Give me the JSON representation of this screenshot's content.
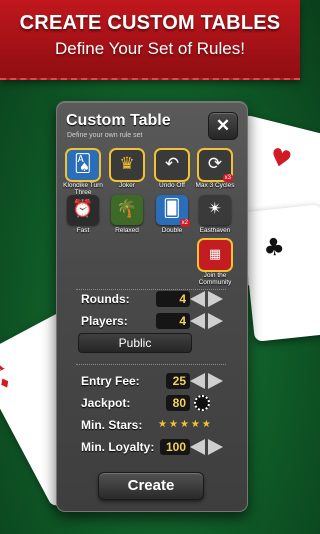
{
  "banner": {
    "title": "CREATE CUSTOM TABLES",
    "subtitle": "Define Your Set of Rules!"
  },
  "panel": {
    "title": "Custom Table",
    "subtitle": "Define your own rule set"
  },
  "rules": [
    {
      "label": "Klondike Turn Three",
      "icon": "cards-icon",
      "selected": true
    },
    {
      "label": "Joker",
      "icon": "jester-hat-icon",
      "selected": true
    },
    {
      "label": "Undo Off",
      "icon": "undo-icon",
      "selected": true
    },
    {
      "label": "Max 3 Cycles",
      "icon": "cycle-icon",
      "badge": "x3",
      "selected": true
    },
    {
      "label": "Fast",
      "icon": "clock-icon",
      "selected": false
    },
    {
      "label": "Relaxed",
      "icon": "palm-tree-icon",
      "selected": false
    },
    {
      "label": "Double",
      "icon": "double-cards-icon",
      "badge": "x2",
      "selected": false
    },
    {
      "label": "Easthaven",
      "icon": "compass-icon",
      "selected": false
    },
    {
      "label": "Join the Community",
      "icon": "community-icon",
      "selected": true
    }
  ],
  "settings": {
    "rounds": {
      "label": "Rounds:",
      "value": "4"
    },
    "players": {
      "label": "Players:",
      "value": "4"
    },
    "visibility": "Public",
    "entry_fee": {
      "label": "Entry Fee:",
      "value": "25"
    },
    "jackpot": {
      "label": "Jackpot:",
      "value": "80"
    },
    "min_stars": {
      "label": "Min. Stars:",
      "stars": 5
    },
    "min_loyalty": {
      "label": "Min. Loyalty:",
      "value": "100"
    }
  },
  "create_label": "Create",
  "colors": {
    "banner": "#b5151b",
    "felt": "#156b30",
    "value_text": "#f3d35b",
    "star": "#f1c232"
  }
}
